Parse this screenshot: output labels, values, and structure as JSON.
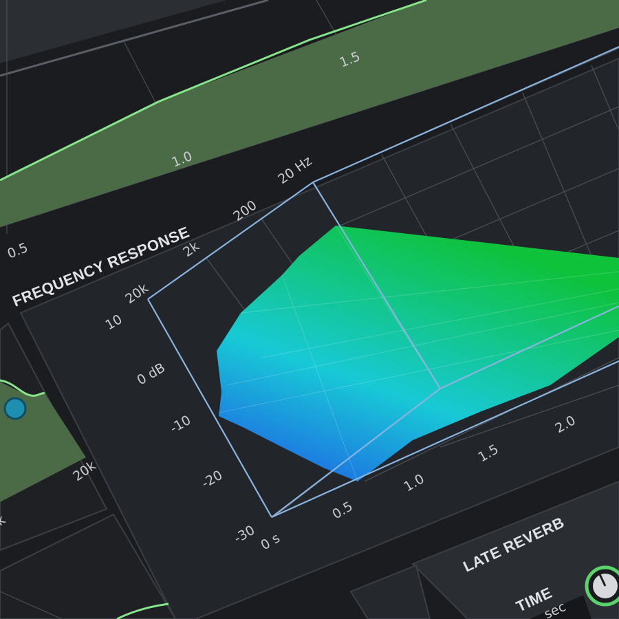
{
  "colors": {
    "background": "#1a1c20",
    "panel": "#222529",
    "panel_border": "#3b3f45",
    "grid": "#4a4e54",
    "curve_green": "#86e58a",
    "fill_green": "#4b6b46",
    "box_blue": "#89b4e0",
    "surface_top": "#11c43a",
    "surface_bottom": "#1e5fe0",
    "knob_ring": "#58d46a"
  },
  "top_chart": {
    "x_ticks": [
      "0.5",
      "1.0",
      "1.5"
    ]
  },
  "frequency_response": {
    "title": "FREQUENCY RESPONSE",
    "freq_ticks": [
      "20 Hz",
      "200",
      "2k",
      "20k"
    ],
    "db_ticks": [
      "10",
      "0 dB",
      "-10",
      "-20",
      "-30"
    ],
    "time_ticks": [
      "0 s",
      "0.5",
      "1.0",
      "1.5",
      "2.0"
    ]
  },
  "left_panel": {
    "freq_tick": "20k",
    "cut_tick": "k"
  },
  "late_reverb": {
    "title": "LATE REVERB",
    "time_label": "TIME",
    "time_value": "sec"
  }
}
